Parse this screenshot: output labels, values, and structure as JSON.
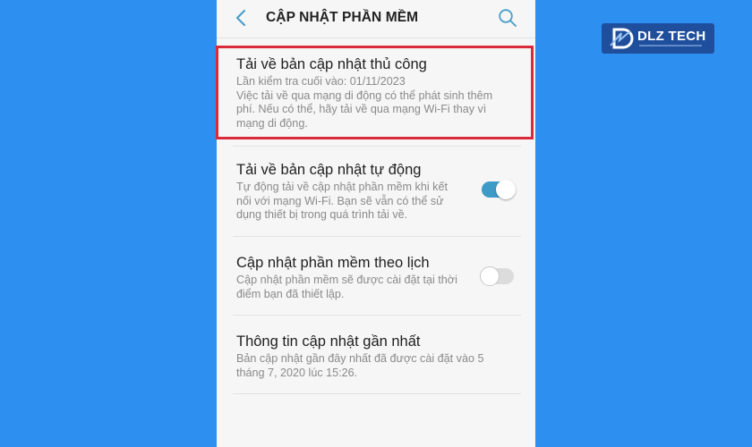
{
  "header": {
    "title": "CẬP NHẬT PHẦN MỀM",
    "back_icon": "chevron-left-icon",
    "search_icon": "search-icon"
  },
  "items": [
    {
      "title": "Tải về bản cập nhật thủ công",
      "subtitle": "Lần kiểm tra cuối vào: 01/11/2023",
      "desc_lines": [
        "Việc tải về qua mạng di động có thể phát sinh thêm",
        "phí. Nếu có thể, hãy tải về qua mạng Wi-Fi thay vì",
        "mạng di động."
      ]
    },
    {
      "title": "Tải về bản cập nhật tự động",
      "desc_lines": [
        "Tự động tải về cập nhật phần mềm khi kết",
        "nối với mạng Wi-Fi. Bạn sẽ vẫn có thể sử",
        "dụng thiết bị trong quá trình tải về."
      ],
      "toggle": "on"
    },
    {
      "title": "Cập nhật phần mềm theo lịch",
      "desc_lines": [
        "Cập nhật phần mềm sẽ được cài đặt tại thời",
        "điểm bạn đã thiết lập."
      ],
      "toggle": "off"
    },
    {
      "title": "Thông tin cập nhật gần nhất",
      "desc_lines": [
        "Bản cập nhật gần đây nhất đã được cài đặt vào 5",
        "tháng 7, 2020 lúc 15:26."
      ]
    }
  ],
  "colors": {
    "background": "#2d8ff0",
    "highlight": "#d92b3a",
    "toggle_on": "#3e9bc7"
  },
  "logo": {
    "text": "DLZ TECH"
  }
}
